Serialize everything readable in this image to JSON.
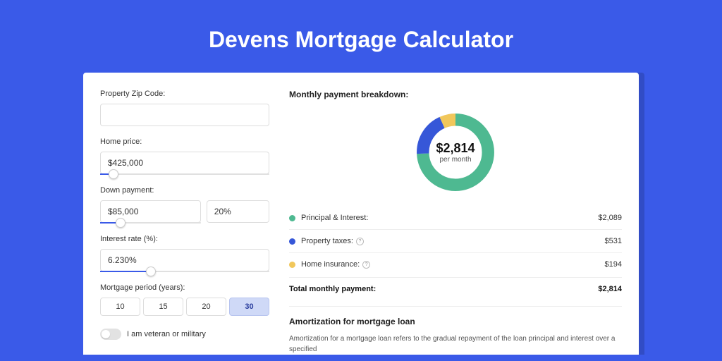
{
  "title": "Devens Mortgage Calculator",
  "form": {
    "zip_label": "Property Zip Code:",
    "zip_value": "",
    "home_price_label": "Home price:",
    "home_price_value": "$425,000",
    "home_price_slider_pct": 8,
    "down_payment_label": "Down payment:",
    "down_payment_value": "$85,000",
    "down_payment_pct_value": "20%",
    "down_payment_slider_pct": 20,
    "interest_label": "Interest rate (%):",
    "interest_value": "6.230%",
    "interest_slider_pct": 30,
    "period_label": "Mortgage period (years):",
    "periods": [
      "10",
      "15",
      "20",
      "30"
    ],
    "period_selected": "30",
    "veteran_label": "I am veteran or military",
    "veteran_on": false
  },
  "breakdown": {
    "title": "Monthly payment breakdown:",
    "center_amount": "$2,814",
    "center_sub": "per month",
    "items": [
      {
        "label": "Principal & Interest:",
        "value": "$2,089",
        "color": "#4eb991",
        "info": false
      },
      {
        "label": "Property taxes:",
        "value": "$531",
        "color": "#3657d8",
        "info": true
      },
      {
        "label": "Home insurance:",
        "value": "$194",
        "color": "#f1c75b",
        "info": true
      }
    ],
    "total_label": "Total monthly payment:",
    "total_value": "$2,814"
  },
  "chart_data": {
    "type": "pie",
    "title": "Monthly payment breakdown",
    "series": [
      {
        "name": "Principal & Interest",
        "value": 2089,
        "color": "#4eb991"
      },
      {
        "name": "Property taxes",
        "value": 531,
        "color": "#3657d8"
      },
      {
        "name": "Home insurance",
        "value": 194,
        "color": "#f1c75b"
      }
    ],
    "total": 2814,
    "unit": "USD per month"
  },
  "amortization": {
    "title": "Amortization for mortgage loan",
    "text": "Amortization for a mortgage loan refers to the gradual repayment of the loan principal and interest over a specified"
  },
  "colors": {
    "accent": "#3a5ae8"
  }
}
